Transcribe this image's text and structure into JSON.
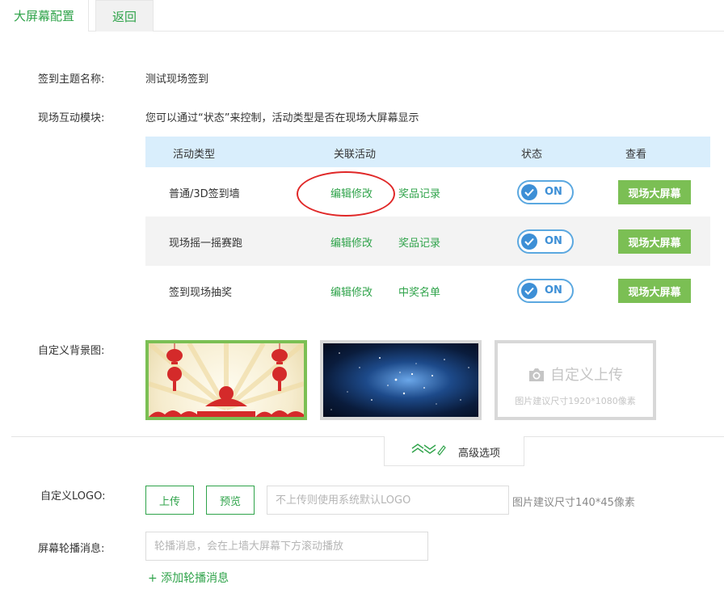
{
  "tabs": {
    "config": "大屏幕配置",
    "back": "返回"
  },
  "theme": {
    "label": "签到主题名称:",
    "value": "测试现场签到"
  },
  "module": {
    "label": "现场互动模块:",
    "desc": "您可以通过“状态”来控制，活动类型是否在现场大屏幕显示"
  },
  "table": {
    "headers": {
      "type": "活动类型",
      "related": "关联活动",
      "status": "状态",
      "view": "查看"
    },
    "rows": [
      {
        "type": "普通/3D签到墙",
        "edit": "编辑修改",
        "link": "奖品记录",
        "status": "ON",
        "view": "现场大屏幕"
      },
      {
        "type": "现场摇一摇赛跑",
        "edit": "编辑修改",
        "link": "奖品记录",
        "status": "ON",
        "view": "现场大屏幕"
      },
      {
        "type": "签到现场抽奖",
        "edit": "编辑修改",
        "link": "中奖名单",
        "status": "ON",
        "view": "现场大屏幕"
      }
    ]
  },
  "background": {
    "label": "自定义背景图:",
    "upload_title": "自定义上传",
    "upload_hint": "图片建议尺寸1920*1080像素"
  },
  "advanced": {
    "label": "高级选项"
  },
  "logo": {
    "label": "自定义LOGO:",
    "upload_btn": "上传",
    "preview_btn": "预览",
    "placeholder": "不上传则使用系统默认LOGO",
    "hint": "图片建议尺寸140*45像素"
  },
  "marquee": {
    "label": "屏幕轮播消息:",
    "placeholder": "轮播消息，会在上墙大屏幕下方滚动播放",
    "add": "+ 添加轮播消息"
  },
  "colors": {
    "accent": "#2fa34a",
    "button_green": "#7bbf54",
    "toggle_blue": "#3d8fd6",
    "header_blue": "#d9eefc",
    "annotation_red": "#e02828"
  }
}
